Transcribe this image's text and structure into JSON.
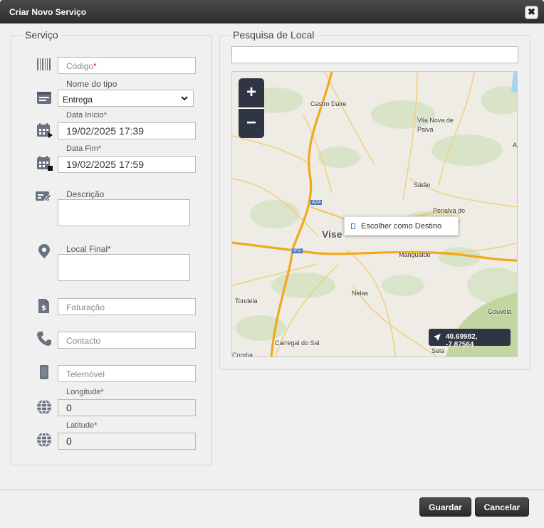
{
  "dialog": {
    "title": "Criar Novo Serviço",
    "close_glyph": "✖"
  },
  "service": {
    "legend": "Serviço",
    "code": {
      "placeholder": "Código",
      "req": "*"
    },
    "type": {
      "label": "Nome do tipo",
      "value": "Entrega"
    },
    "start": {
      "label": "Data Início",
      "req": "*",
      "value": "19/02/2025 17:39"
    },
    "end": {
      "label": "Data Fim",
      "req": "*",
      "value": "19/02/2025 17:59"
    },
    "description": {
      "label": "Descrição",
      "value": ""
    },
    "final_location": {
      "label": "Local Final",
      "req": "*",
      "value": ""
    },
    "billing": {
      "placeholder": "Faturação"
    },
    "contact": {
      "placeholder": "Contacto"
    },
    "mobile": {
      "placeholder": "Telemóvel"
    },
    "longitude": {
      "label": "Longitude",
      "req": "*",
      "value": "0"
    },
    "latitude": {
      "label": "Latitude",
      "req": "*",
      "value": "0"
    }
  },
  "location": {
    "legend": "Pesquisa de Local",
    "search_value": "",
    "map": {
      "zoom_in": "+",
      "zoom_out": "−",
      "context_menu": "Escolher como Destino",
      "coords": "40.69982, -7.87564",
      "places": {
        "castro_daire": "Castro Daire",
        "vila_nova": "Vila Nova de",
        "paiva": "Paiva",
        "satao": "Sátão",
        "penalva": "Penalva do",
        "viseu": "Vise",
        "mangualde": "Mangualde",
        "nelas": "Nelas",
        "tondela": "Tondela",
        "gouveia": "Gouveia",
        "carregal": "Carregal do Sal",
        "seia": "Seia",
        "comba": "Comba",
        "a24": "A24",
        "ip3": "IP3",
        "edge_a": "A"
      }
    }
  },
  "footer": {
    "save": "Guardar",
    "cancel": "Cancelar"
  }
}
